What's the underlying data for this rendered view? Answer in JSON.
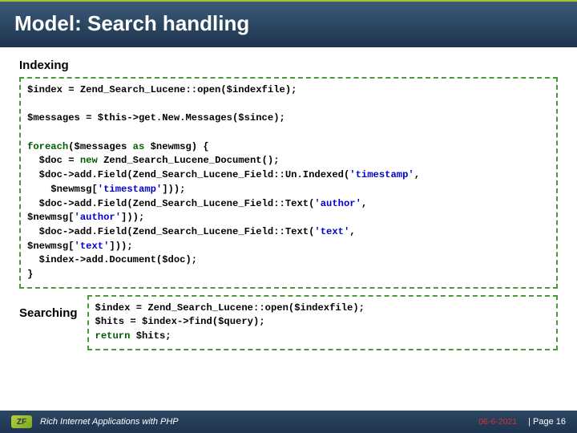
{
  "title": "Model: Search handling",
  "sections": {
    "indexing_label": "Indexing",
    "searching_label": "Searching"
  },
  "code": {
    "indexing": {
      "line1_a": "$index = Zend_Search_Lucene:",
      "line1_b": ":open($indexfile);",
      "line2_a": "$messages = $this->get.",
      "line2_b": "New.",
      "line2_c": "Messages($since);",
      "line3": "foreach",
      "line3b": "($messages ",
      "line3c": "as",
      "line3d": " $newmsg) {",
      "line4a": "  $doc = ",
      "line4b": "new",
      "line4c": " Zend_Search_Lucene_Document();",
      "line5a": "  $doc->add.",
      "line5b": "Field(Zend_Search_Lucene_Field:",
      "line5c": ":Un.Indexed(",
      "line5d": "'timestamp'",
      "line5e": ",\n    $newmsg[",
      "line5f": "'timestamp'",
      "line5g": "]));",
      "line6a": "  $doc->add.",
      "line6b": "Field(Zend_Search_Lucene_Field:",
      "line6c": ":Text(",
      "line6d": "'author'",
      "line6e": ",\n$newmsg[",
      "line6f": "'author'",
      "line6g": "]));",
      "line7a": "  $doc->add.",
      "line7b": "Field(Zend_Search_Lucene_Field:",
      "line7c": ":Text(",
      "line7d": "'text'",
      "line7e": ",\n$newmsg[",
      "line7f": "'text'",
      "line7g": "]));",
      "line8": "  $index->add.",
      "line8b": "Document($doc);",
      "line9": "}"
    },
    "searching": {
      "line1a": "$index = Zend_Search_Lucene:",
      "line1b": ":open($indexfile);",
      "line2": "$hits = $index->find($query);",
      "line3a": "return",
      "line3b": " $hits;"
    }
  },
  "footer": {
    "logo_text": "ZF",
    "title": "Rich Internet Applications with PHP",
    "date": "06-6-2021",
    "page": "| Page 16"
  }
}
